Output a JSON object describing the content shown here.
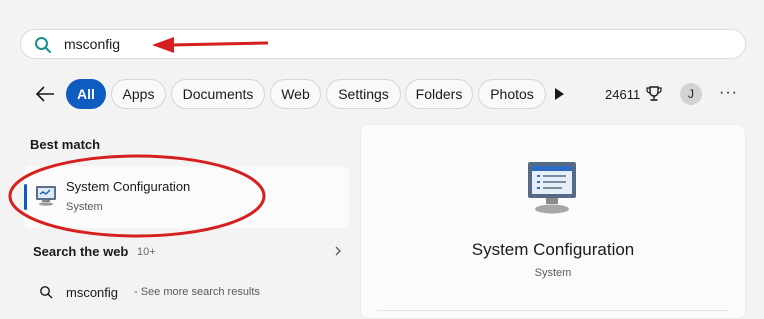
{
  "search": {
    "query": "msconfig"
  },
  "filters": {
    "chips": [
      {
        "label": "All",
        "active": true
      },
      {
        "label": "Apps"
      },
      {
        "label": "Documents"
      },
      {
        "label": "Web"
      },
      {
        "label": "Settings"
      },
      {
        "label": "Folders"
      },
      {
        "label": "Photos"
      }
    ],
    "points": "24611",
    "avatar_initial": "J",
    "more": "···"
  },
  "best_match": {
    "heading": "Best match",
    "title": "System Configuration",
    "subtitle": "System"
  },
  "web": {
    "heading": "Search the web",
    "count": "10+",
    "result_term": "msconfig",
    "result_hint": "- See more search results"
  },
  "detail": {
    "title": "System Configuration",
    "subtitle": "System"
  },
  "colors": {
    "accent": "#0f5cc0",
    "annotation": "#d62020",
    "background": "#f3f3f3"
  },
  "icons": [
    "search-icon",
    "back-arrow-icon",
    "play-icon",
    "trophy-icon",
    "more-icon",
    "system-configuration-icon",
    "chevron-right-icon"
  ]
}
